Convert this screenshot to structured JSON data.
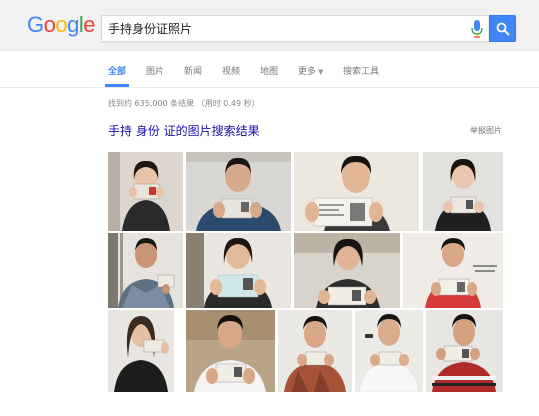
{
  "header": {
    "logo_text": [
      "G",
      "o",
      "o",
      "g",
      "l",
      "e"
    ],
    "logo_colors": [
      "#4285f4",
      "#ea4335",
      "#fbbc05",
      "#4285f4",
      "#34a853",
      "#ea4335"
    ],
    "search_value": "手持身份证照片",
    "accent": "#4285f4"
  },
  "tabs": [
    {
      "label": "全部",
      "active": true
    },
    {
      "label": "图片"
    },
    {
      "label": "新闻"
    },
    {
      "label": "视频"
    },
    {
      "label": "地图"
    },
    {
      "label": "更多"
    },
    {
      "label": "搜索工具"
    }
  ],
  "results": {
    "stats": "找到约 635,000 条结果 （用时 0.49 秒）",
    "image_section_title": "手持 身份 证的图片搜索结果",
    "report_link": "举报图片"
  },
  "images": [
    {
      "name": "photo-woman-holding-id-card"
    },
    {
      "name": "photo-man-holding-id-card"
    },
    {
      "name": "photo-man-holding-id-card"
    },
    {
      "name": "photo-woman-holding-id-card"
    },
    {
      "name": "photo-man-holding-id-card"
    },
    {
      "name": "photo-woman-holding-id-card"
    },
    {
      "name": "photo-woman-holding-id-card"
    },
    {
      "name": "photo-man-holding-id-card"
    },
    {
      "name": "photo-woman-holding-id-card"
    },
    {
      "name": "photo-man-holding-id-card"
    },
    {
      "name": "photo-man-holding-id-card"
    },
    {
      "name": "photo-man-holding-id-card"
    },
    {
      "name": "photo-man-holding-id-card"
    }
  ]
}
